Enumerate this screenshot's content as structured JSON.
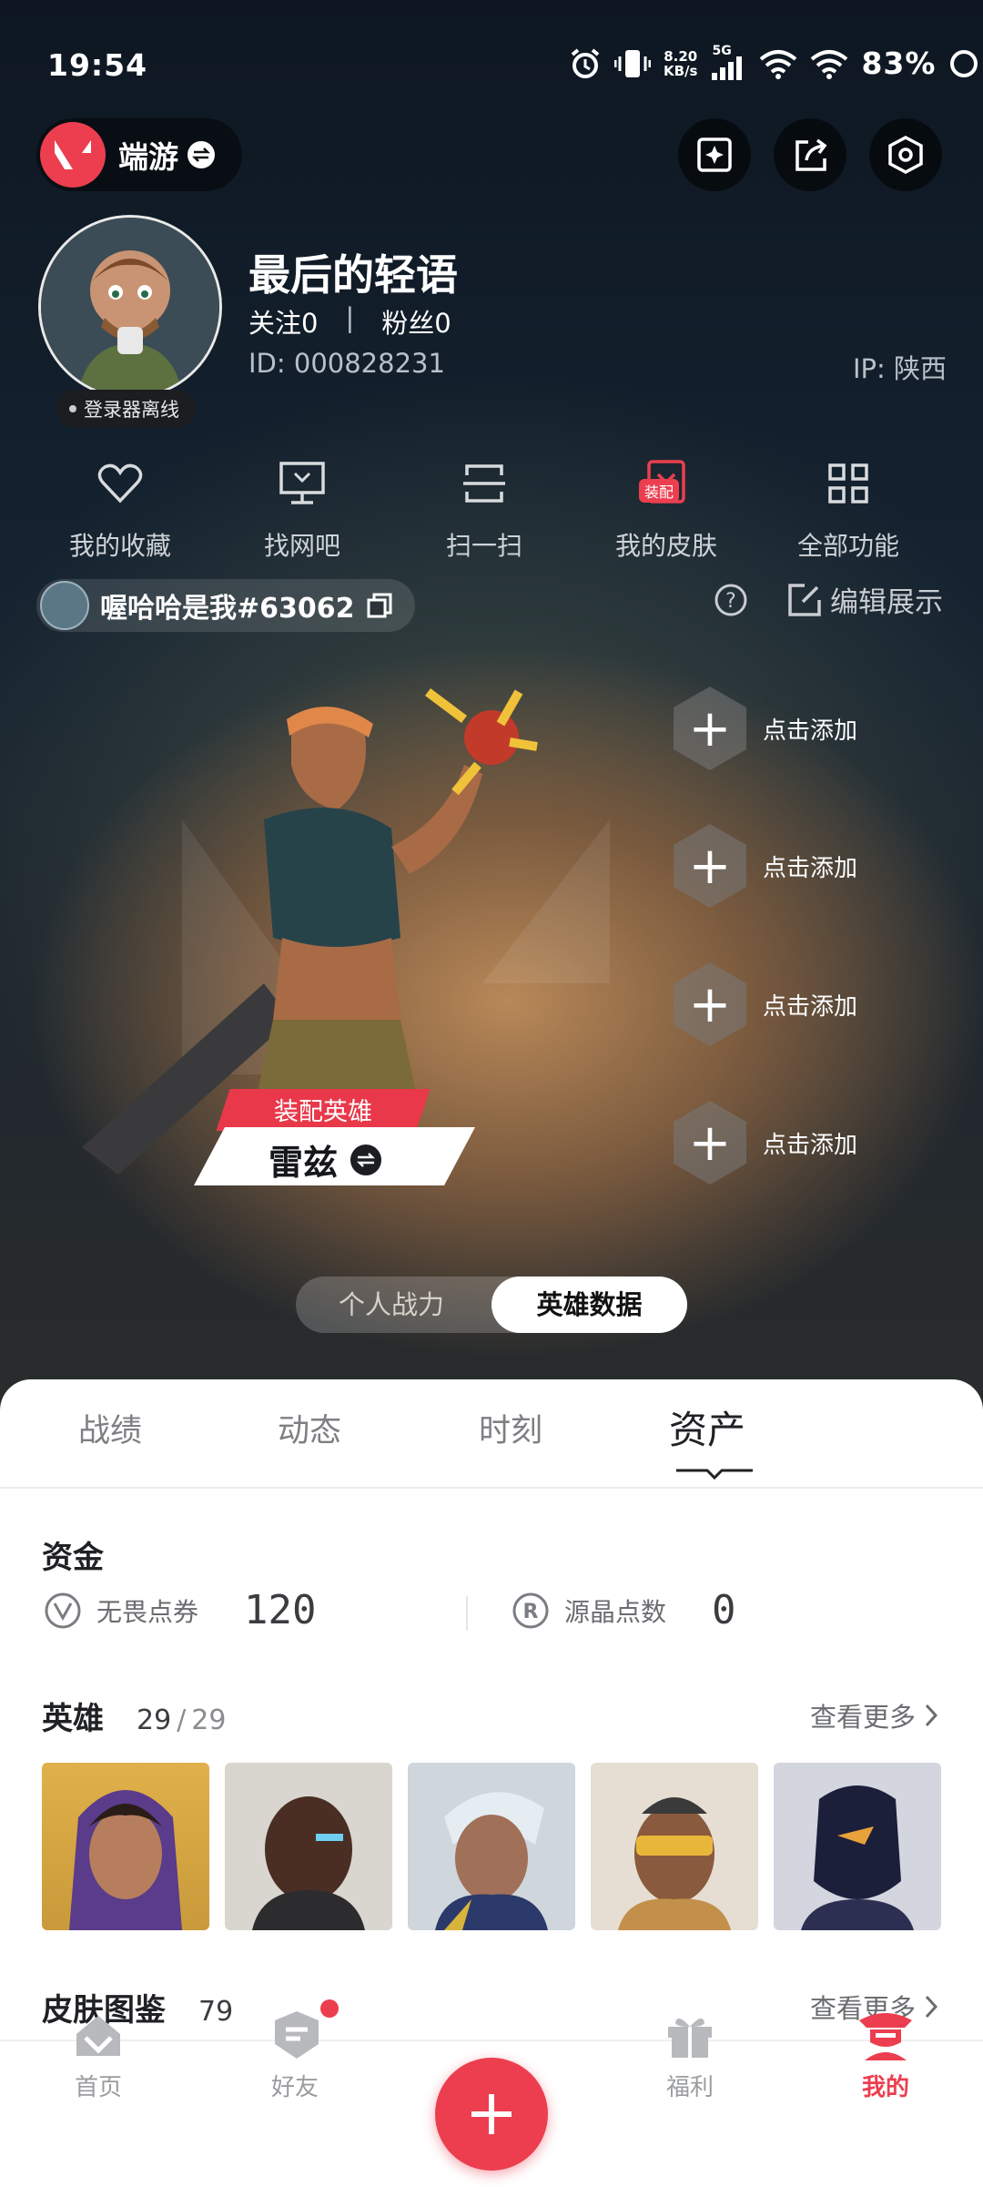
{
  "status_bar": {
    "time": "19:54",
    "net_speed_value": "8.20",
    "net_speed_unit": "KB/s",
    "network": "5G",
    "battery": "83%"
  },
  "top_bar": {
    "app_label": "端游"
  },
  "profile": {
    "name": "最后的轻语",
    "follow": "关注0",
    "separator": "|",
    "fans": "粉丝0",
    "id": "ID: 000828231",
    "ip": "IP: 陕西",
    "launcher_status": "登录器离线"
  },
  "quick_menu": [
    {
      "label": "我的收藏",
      "icon": "heart-icon"
    },
    {
      "label": "找网吧",
      "icon": "monitor-icon"
    },
    {
      "label": "扫一扫",
      "icon": "scan-icon"
    },
    {
      "label": "我的皮肤",
      "icon": "skin-icon",
      "badge": "装配"
    },
    {
      "label": "全部功能",
      "icon": "grid-icon"
    }
  ],
  "game_account": {
    "riot_id": "喔哈哈是我#63062",
    "edit_label": "编辑展示"
  },
  "showcase": {
    "equip_tag": "装配英雄",
    "agent_name": "雷兹",
    "add_slots": [
      "点击添加",
      "点击添加",
      "点击添加",
      "点击添加"
    ]
  },
  "toggle": {
    "option_left": "个人战力",
    "option_right": "英雄数据",
    "active": "英雄数据"
  },
  "tabs": {
    "items": [
      "战绩",
      "动态",
      "时刻",
      "资产"
    ],
    "active": "资产"
  },
  "assets": {
    "funds_title": "资金",
    "vp_label": "无畏点券",
    "vp_value": "120",
    "rp_label": "源晶点数",
    "rp_value": "0"
  },
  "agents": {
    "title": "英雄",
    "owned": "29",
    "slash": "/",
    "total": "29",
    "more_label": "查看更多"
  },
  "skins": {
    "title": "皮肤图鉴",
    "count": "79",
    "more_label": "查看更多"
  },
  "bottom_nav": {
    "items": [
      "首页",
      "好友",
      "福利",
      "我的"
    ],
    "active": "我的"
  },
  "colors": {
    "accent_red": "#ec3e4f",
    "toggle_active_bg": "#ffffff"
  }
}
